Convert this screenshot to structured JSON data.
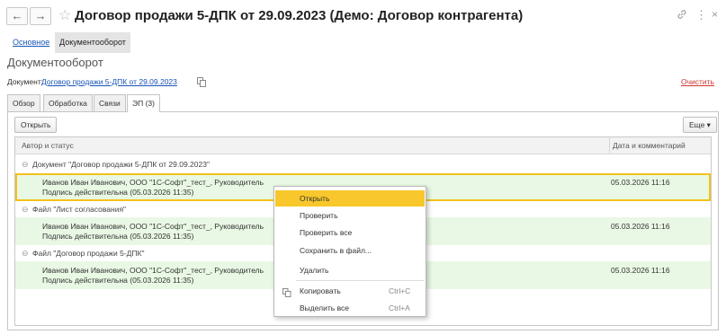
{
  "window": {
    "title": "Договор продажи 5-ДПК от 29.09.2023 (Демо: Договор контрагента)",
    "back_icon": "←",
    "forward_icon": "→",
    "star_icon": "☆",
    "link_icon": "🔗",
    "more_icon": "⋮",
    "close_icon": "×"
  },
  "top_tabs": [
    {
      "label": "Основное"
    },
    {
      "label": "Документооборот"
    }
  ],
  "section_title": "Документооборот",
  "document": {
    "label": "Документ:",
    "link": "Договор продажи 5-ДПК от 29.09.2023",
    "clear": "Очистить"
  },
  "inner_tabs": [
    {
      "label": "Обзор"
    },
    {
      "label": "Обработка"
    },
    {
      "label": "Связи"
    },
    {
      "label": "ЭП (3)"
    }
  ],
  "toolbar": {
    "open": "Открыть",
    "more": "Еще ▾"
  },
  "table": {
    "col_author": "Автор и статус",
    "col_date": "Дата и комментарий",
    "groups": [
      {
        "title": "Документ \"Договор продажи 5-ДПК от 29.09.2023\"",
        "signer": "Иванов Иван Иванович, ООО \"1С-Софт\"_тест_, Руководитель",
        "status": "Подпись действительна (05.03.2026 11:35)",
        "date": "05.03.2026 11:16"
      },
      {
        "title": "Файл \"Лист согласования\"",
        "signer": "Иванов Иван Иванович, ООО \"1С-Софт\"_тест_, Руководитель",
        "status": "Подпись действительна (05.03.2026 11:35)",
        "date": "05.03.2026 11:16"
      },
      {
        "title": "Файл \"Договор продажи 5-ДПК\"",
        "signer": "Иванов Иван Иванович, ООО \"1С-Софт\"_тест_, Руководитель",
        "status": "Подпись действительна (05.03.2026 11:35)",
        "date": "05.03.2026 11:16"
      }
    ]
  },
  "context_menu": {
    "open": "Открыть",
    "check": "Проверить",
    "check_all": "Проверить все",
    "save_to_file": "Сохранить в файл...",
    "delete": "Удалить",
    "copy": "Копировать",
    "copy_shortcut": "Ctrl+C",
    "select_all": "Выделить все",
    "select_all_shortcut": "Ctrl+A"
  }
}
